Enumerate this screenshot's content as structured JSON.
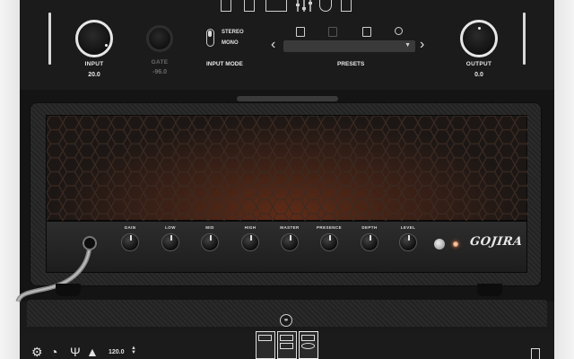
{
  "header": {
    "input": {
      "label": "INPUT",
      "value": "20.0"
    },
    "gate": {
      "label": "GATE",
      "value": "-96.0"
    },
    "input_mode": {
      "label": "INPUT MODE",
      "options": [
        "STEREO",
        "MONO"
      ],
      "selected": "MONO"
    },
    "presets": {
      "label": "PRESETS",
      "current": ""
    },
    "output": {
      "label": "OUTPUT",
      "value": "0.0"
    }
  },
  "amp": {
    "knobs": [
      "GAIN",
      "LOW",
      "MID",
      "HIGH",
      "MASTER",
      "PRESENCE",
      "DEPTH",
      "LEVEL"
    ],
    "brand": "GOJIRA"
  },
  "toolbar": {
    "bpm": "120.0"
  },
  "colors": {
    "background": "#1b1b1b",
    "frame": "#f0f0f0",
    "text": "#e8e8e8",
    "led": "#ff8a50"
  }
}
